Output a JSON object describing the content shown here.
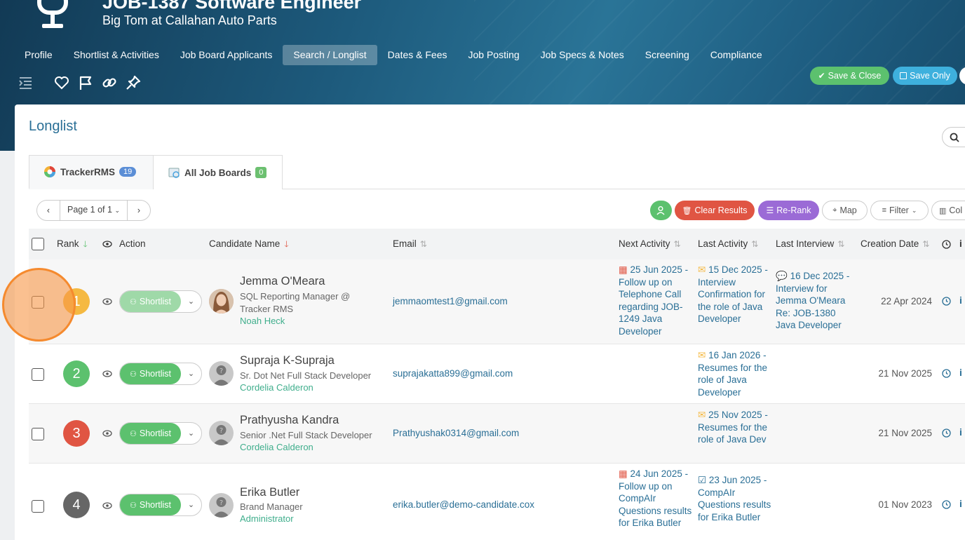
{
  "header": {
    "title": "JOB-1387 Software Engineer",
    "subtitle": "Big Tom at Callahan Auto Parts",
    "nav": [
      "Profile",
      "Shortlist & Activities",
      "Job Board Applicants",
      "Search / Longlist",
      "Dates & Fees",
      "Job Posting",
      "Job Specs & Notes",
      "Screening",
      "Compliance"
    ],
    "active_nav": "Search / Longlist",
    "save_close": "Save & Close",
    "save_only": "Save Only"
  },
  "panel": {
    "title": "Longlist",
    "tabs": [
      {
        "label": "TrackerRMS",
        "count": "19"
      },
      {
        "label": "All Job Boards",
        "count": "0"
      }
    ],
    "pager": {
      "label": "Page 1 of 1"
    },
    "actions": {
      "clear": "Clear Results",
      "rerank": "Re-Rank",
      "map": "Map",
      "filter": "Filter",
      "columns": "Col"
    }
  },
  "table": {
    "headers": {
      "rank": "Rank",
      "action": "Action",
      "name": "Candidate Name",
      "email": "Email",
      "next": "Next Activity",
      "last": "Last Activity",
      "interview": "Last Interview",
      "created": "Creation Date"
    },
    "rows": [
      {
        "rank": "1",
        "name": "Jemma O'Meara",
        "title": "SQL Reporting Manager @ Tracker RMS",
        "owner": "Noah Heck",
        "email": "jemmaomtest1@gmail.com",
        "next": "25 Jun 2025 - Follow up on Telephone Call regarding JOB-1249 Java Developer",
        "last": "15 Dec 2025 - Interview Confirmation for the role of Java Developer",
        "interview": "16 Dec 2025 - Interview for Jemma O'Meara Re: JOB-1380 Java Developer",
        "created": "22 Apr 2024",
        "shortlist": "Shortlist",
        "color": "#f5b942"
      },
      {
        "rank": "2",
        "name": "Supraja K-Supraja",
        "title": "Sr. Dot Net Full Stack Developer",
        "owner": "Cordelia Calderon",
        "email": "suprajakatta899@gmail.com",
        "next": "",
        "last": "16 Jan 2026 - Resumes for the role of Java Developer",
        "interview": "",
        "created": "21 Nov 2025",
        "shortlist": "Shortlist",
        "color": "#5cc16e"
      },
      {
        "rank": "3",
        "name": "Prathyusha Kandra",
        "title": "Senior .Net Full Stack Developer",
        "owner": "Cordelia Calderon",
        "email": "Prathyushak0314@gmail.com",
        "next": "",
        "last": "25 Nov 2025 - Resumes for the role of Java Dev",
        "interview": "",
        "created": "21 Nov 2025",
        "shortlist": "Shortlist",
        "color": "#e05543"
      },
      {
        "rank": "4",
        "name": "Erika Butler",
        "title": "Brand Manager",
        "owner": "Administrator",
        "email": "erika.butler@demo-candidate.cox",
        "next": "24 Jun 2025 - Follow up on CompAIr Questions results for Erika Butler",
        "last": "23 Jun 2025 - CompAIr Questions results for Erika Butler",
        "interview": "",
        "created": "01 Nov 2023",
        "shortlist": "Shortlist",
        "color": "#666666"
      }
    ]
  }
}
